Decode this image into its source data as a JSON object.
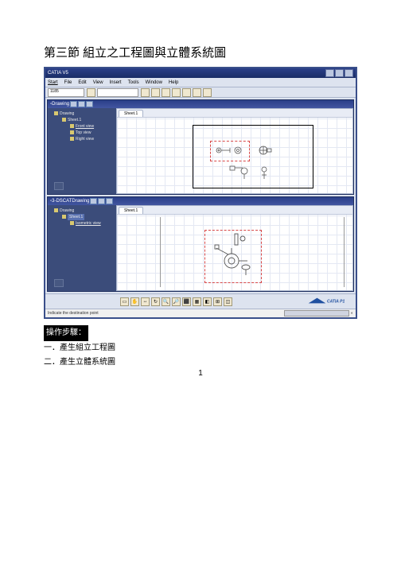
{
  "title": "第三節 組立之工程圖與立體系統圖",
  "app": {
    "title": "CATIA V5"
  },
  "menu": {
    "i0": "Start",
    "i1": "File",
    "i2": "Edit",
    "i3": "View",
    "i4": "Insert",
    "i5": "Tools",
    "i6": "Window",
    "i7": "Help"
  },
  "toolbar": {
    "combo": "1185",
    "slot2": ""
  },
  "win1": {
    "title": "Drawing",
    "tree": {
      "root": "Drawing",
      "n1": "Sheet.1",
      "n2": "Front view",
      "n3": "Top view",
      "n4": "Right view"
    },
    "tab": "Sheet.1"
  },
  "win2": {
    "title": "3-DSCATDrawing",
    "tree": {
      "root": "Drawing",
      "n1": "Sheet.1",
      "n2": "Isometric view"
    },
    "tab": "Sheet.1"
  },
  "status": {
    "text": "Indicate the destination point"
  },
  "steps": {
    "hdr": "操作步驟：",
    "s1": "一．產生組立工程圖",
    "s2": "二．產生立體系統圖"
  },
  "page_num": "1"
}
